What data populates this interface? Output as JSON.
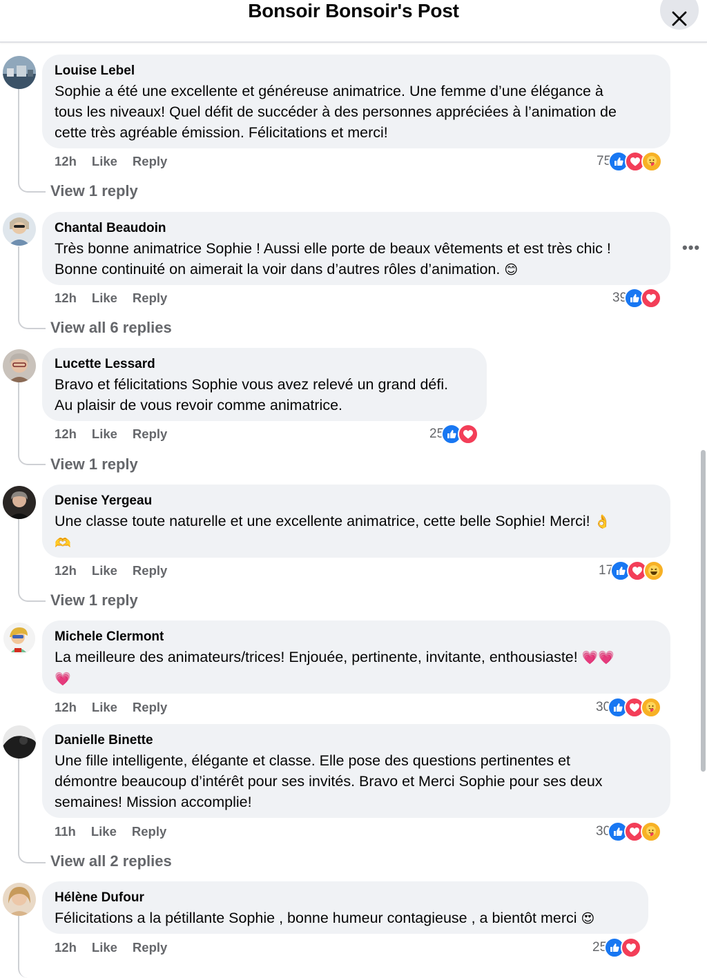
{
  "header": {
    "title": "Bonsoir Bonsoir's Post"
  },
  "comments": [
    {
      "author": "Louise Lebel",
      "lines": [
        "Sophie a été une excellente et généreuse animatrice. Une femme d’une élégance à",
        "tous les niveaux! Quel défit de succéder à des personnes appréciées à l’animation de",
        "cette très agréable émission. Félicitations et merci!"
      ],
      "time": "12h",
      "like": "Like",
      "reply": "Reply",
      "reaction_count": "75",
      "reactions": [
        "like",
        "love",
        "care"
      ],
      "replies": "View 1 reply"
    },
    {
      "author": "Chantal Beaudoin",
      "lines": [
        "Très bonne animatrice Sophie ! Aussi elle porte de beaux vêtements et est très chic !",
        "Bonne continuité on aimerait la voir dans d’autres rôles d’animation."
      ],
      "emoji": "😊",
      "time": "12h",
      "like": "Like",
      "reply": "Reply",
      "reaction_count": "39",
      "reactions": [
        "like",
        "love"
      ],
      "replies": "View all 6 replies",
      "more": "•••"
    },
    {
      "author": "Lucette Lessard",
      "lines": [
        "Bravo et félicitations Sophie vous avez relevé un grand défi.",
        "Au plaisir de vous revoir comme animatrice."
      ],
      "time": "12h",
      "like": "Like",
      "reply": "Reply",
      "reaction_count": "25",
      "reactions": [
        "like",
        "love"
      ],
      "replies": "View 1 reply"
    },
    {
      "author": "Denise Yergeau",
      "lines": [
        "Une classe toute naturelle et une excellente animatrice, cette belle Sophie! Merci!"
      ],
      "emoji": "👌",
      "emoji2": "🫶",
      "time": "12h",
      "like": "Like",
      "reply": "Reply",
      "reaction_count": "17",
      "reactions": [
        "like",
        "love",
        "haha"
      ],
      "replies": "View 1 reply"
    },
    {
      "author": "Michele Clermont",
      "lines": [
        "La meilleure des animateurs/trices! Enjouée, pertinente, invitante, enthousiaste!"
      ],
      "emoji": "💗💗",
      "emoji2": "💗",
      "time": "12h",
      "like": "Like",
      "reply": "Reply",
      "reaction_count": "30",
      "reactions": [
        "like",
        "love",
        "care"
      ]
    },
    {
      "author": "Danielle Binette",
      "lines": [
        "Une fille intelligente, élégante et classe. Elle pose des questions pertinentes et",
        "démontre beaucoup d’intérêt pour ses invités. Bravo et Merci Sophie pour ses deux",
        "semaines! Mission accomplie!"
      ],
      "time": "11h",
      "like": "Like",
      "reply": "Reply",
      "reaction_count": "30",
      "reactions": [
        "like",
        "love",
        "care"
      ],
      "replies": "View all 2 replies"
    },
    {
      "author": "Hélène Dufour",
      "lines": [
        "Félicitations a la pétillante Sophie , bonne humeur contagieuse , a bientôt merci"
      ],
      "emoji": "😍",
      "time": "12h",
      "like": "Like",
      "reply": "Reply",
      "reaction_count": "25",
      "reactions": [
        "like",
        "love"
      ]
    }
  ],
  "colors": {
    "like": "#1877f2",
    "love": "#f33e58",
    "care": "#f7b125",
    "bubble": "#f0f2f5",
    "meta": "#65676b"
  }
}
